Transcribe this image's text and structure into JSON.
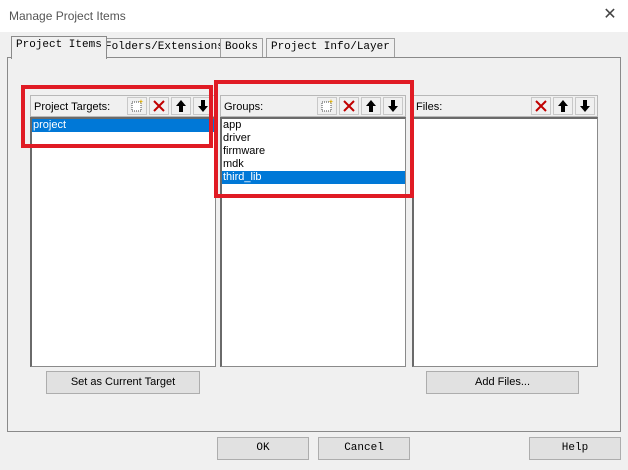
{
  "window": {
    "title": "Manage Project Items",
    "close_symbol": "✕"
  },
  "tabs": [
    {
      "label": "Project Items",
      "active": true
    },
    {
      "label": "Folders/Extensions",
      "active": false
    },
    {
      "label": "Books",
      "active": false
    },
    {
      "label": "Project Info/Layer",
      "active": false
    }
  ],
  "panes": {
    "targets": {
      "label": "Project Targets:",
      "items": [
        {
          "text": "project",
          "selected": true
        }
      ],
      "toolbar": [
        "new-icon",
        "delete-icon",
        "move-up-icon",
        "move-down-icon"
      ]
    },
    "groups": {
      "label": "Groups:",
      "items": [
        {
          "text": "app",
          "selected": false
        },
        {
          "text": "driver",
          "selected": false
        },
        {
          "text": "firmware",
          "selected": false
        },
        {
          "text": "mdk",
          "selected": false
        },
        {
          "text": "third_lib",
          "selected": true
        }
      ],
      "toolbar": [
        "new-icon",
        "delete-icon",
        "move-up-icon",
        "move-down-icon"
      ]
    },
    "files": {
      "label": "Files:",
      "items": [],
      "toolbar": [
        "delete-icon",
        "move-up-icon",
        "move-down-icon"
      ]
    }
  },
  "buttons": {
    "set_current_target": "Set as Current Target",
    "add_files": "Add Files...",
    "ok": "OK",
    "cancel": "Cancel",
    "help": "Help"
  },
  "colors": {
    "selection": "#0078d7",
    "highlight_box": "#e01b24",
    "delete_icon": "#c00000"
  }
}
